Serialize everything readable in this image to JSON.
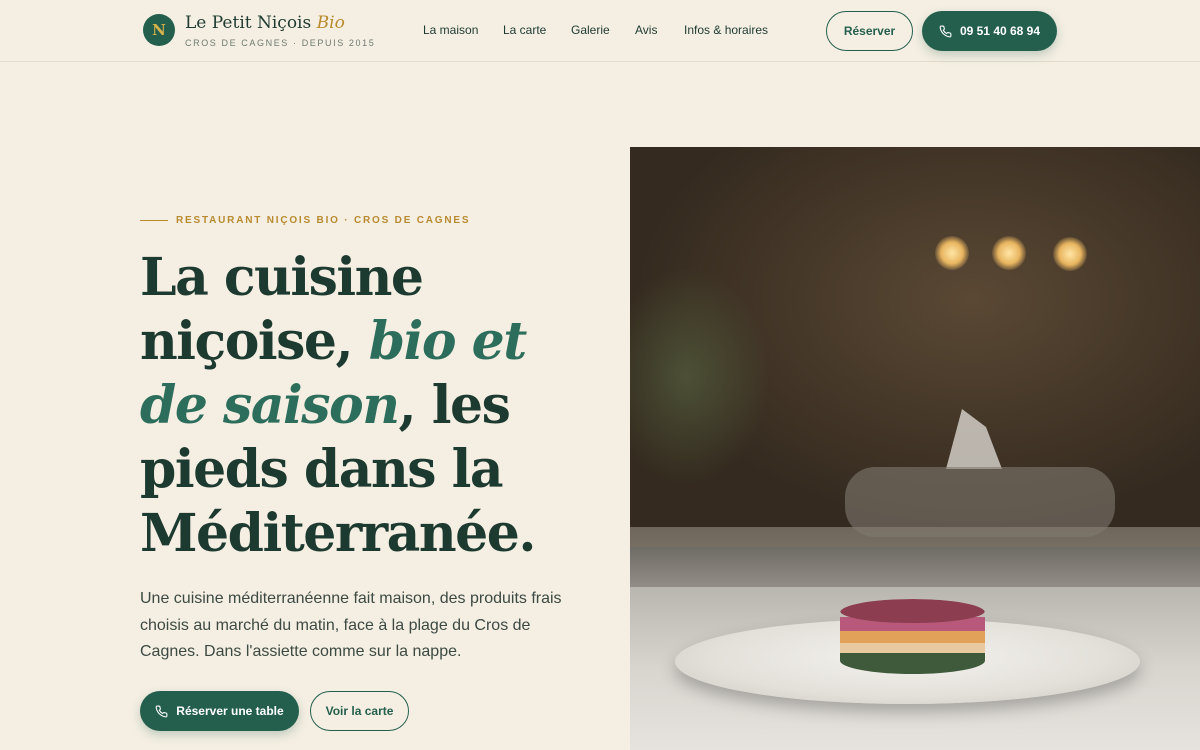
{
  "header": {
    "logo_letter": "N",
    "brand_name": "Le Petit Niçois",
    "brand_accent": "Bio",
    "brand_sub": "CROS DE CAGNES · DEPUIS 2015",
    "nav": [
      "La maison",
      "La carte",
      "Galerie",
      "Avis",
      "Infos & horaires"
    ],
    "reserve_label": "Réserver",
    "phone_label": "09 51 40 68 94"
  },
  "hero": {
    "eyebrow": "RESTAURANT NIÇOIS BIO · CROS DE CAGNES",
    "headline_part1": "La cuisine niçoise, ",
    "headline_emphasis": "bio et de saison",
    "headline_part2": ", les pieds dans la Méditerranée.",
    "lede": "Une cuisine méditerranéenne fait maison, des produits frais choisis au marché du matin, face à la plage du Cros de Cagnes. Dans l'assiette comme sur la nappe.",
    "primary_cta": "Réserver une table",
    "secondary_cta": "Voir la carte"
  },
  "colors": {
    "background": "#f5efe3",
    "primary": "#245f4e",
    "accent_gold": "#b98a2e",
    "text": "#1d3a31"
  },
  "icons": {
    "phone": "phone-icon"
  }
}
